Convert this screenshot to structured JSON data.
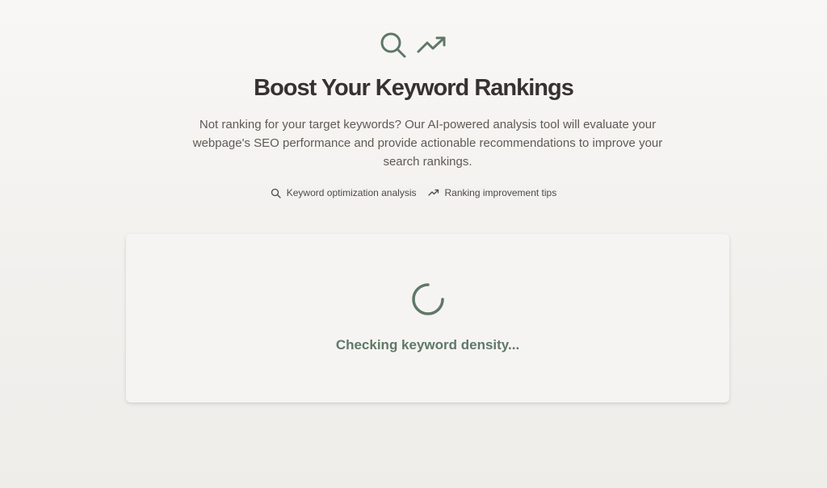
{
  "hero": {
    "icons": [
      "search-icon",
      "trending-up-icon"
    ],
    "title": "Boost Your Keyword Rankings",
    "description": "Not ranking for your target keywords? Our AI-powered analysis tool will evaluate your webpage's SEO performance and provide actionable recommendations to improve your search rankings."
  },
  "features": [
    {
      "icon": "search-icon",
      "label": "Keyword optimization analysis"
    },
    {
      "icon": "trending-up-icon",
      "label": "Ranking improvement tips"
    }
  ],
  "loading_card": {
    "icon": "spinner-icon",
    "status": "Checking keyword density..."
  },
  "colors": {
    "accent": "#5f7868",
    "title": "#353230",
    "body_text": "#5f5a55",
    "background": "#f8f7f5",
    "card": "#f6f4f2"
  }
}
